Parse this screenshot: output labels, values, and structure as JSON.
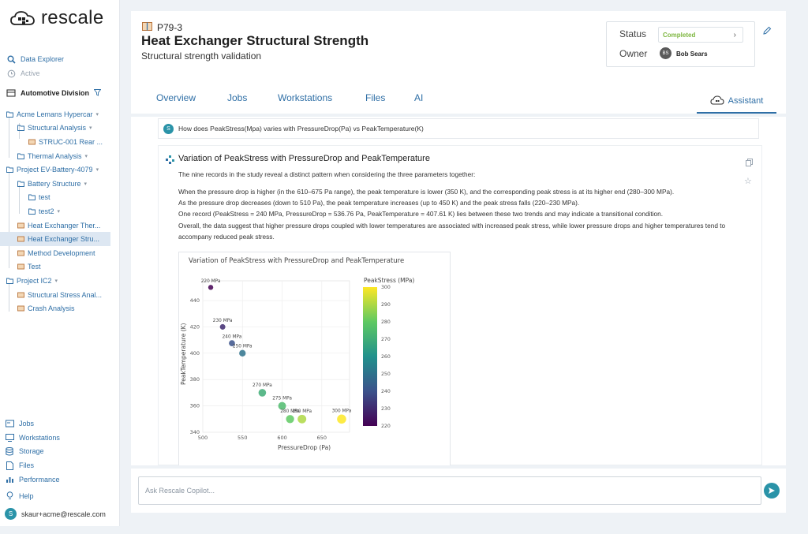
{
  "app": {
    "name": "rescale"
  },
  "sidebar": {
    "top": [
      {
        "label": "Data Explorer",
        "icon": "search-icon"
      },
      {
        "label": "Active",
        "icon": "clock-icon"
      }
    ],
    "division": "Automotive Division",
    "tree": [
      {
        "label": "Acme Lemans Hypercar",
        "caret": "▾"
      },
      {
        "label": "Structural Analysis",
        "caret": "▾"
      },
      {
        "label": "STRUC-001 Rear ...",
        "caret": ""
      },
      {
        "label": "Thermal Analysis",
        "caret": "▾"
      },
      {
        "label": "Project EV-Battery-4079",
        "caret": "▾"
      },
      {
        "label": "Battery Structure",
        "caret": "▾"
      },
      {
        "label": "test",
        "caret": ""
      },
      {
        "label": "test2",
        "caret": "▾"
      },
      {
        "label": "Heat Exchanger Ther...",
        "caret": ""
      },
      {
        "label": "Heat Exchanger Stru...",
        "caret": ""
      },
      {
        "label": "Method Development",
        "caret": ""
      },
      {
        "label": "Test",
        "caret": ""
      },
      {
        "label": "Project IC2",
        "caret": "▾"
      },
      {
        "label": "Structural Stress Anal...",
        "caret": ""
      },
      {
        "label": "Crash Analysis",
        "caret": ""
      }
    ],
    "bottom": [
      {
        "label": "Jobs",
        "icon": "jobs-icon"
      },
      {
        "label": "Workstations",
        "icon": "monitor-icon"
      },
      {
        "label": "Storage",
        "icon": "database-icon"
      },
      {
        "label": "Files",
        "icon": "file-icon"
      },
      {
        "label": "Performance",
        "icon": "chart-icon"
      },
      {
        "label": "Help",
        "icon": "lightbulb-icon"
      }
    ],
    "user": {
      "initial": "S",
      "email": "skaur+acme@rescale.com"
    }
  },
  "project": {
    "id": "P79-3",
    "title": "Heat Exchanger Structural Strength",
    "subtitle": "Structural strength validation",
    "status_label": "Status",
    "status_value": "Completed",
    "owner_label": "Owner",
    "owner_initials": "BS",
    "owner_name": "Bob Sears"
  },
  "tabs": [
    "Overview",
    "Jobs",
    "Workstations",
    "Files",
    "AI"
  ],
  "assistant_tab": "Assistant",
  "chat": {
    "question_avatar": "S",
    "question": "How does PeakStress(Mpa) varies with PressureDrop(Pa) vs PeakTemperature(K)",
    "answer_title": "Variation of PeakStress with PressureDrop and PeakTemperature",
    "answer_intro": "The nine records in the study reveal a distinct pattern when considering the three parameters together:",
    "answer_paras": [
      "When the pressure drop is higher (in the 610–675 Pa range), the peak temperature is lower (350 K), and the corresponding peak stress is at its higher end (280–300 MPa).",
      "As the pressure drop decreases (down to 510 Pa), the peak temperature increases (up to 450 K) and the peak stress falls (220–230 MPa).",
      "One record (PeakStress = 240 MPa, PressureDrop = 536.76 Pa, PeakTemperature = 407.61 K) lies between these two trends and may indicate a transitional condition.",
      "Overall, the data suggest that higher pressure drops coupled with lower temperatures are associated with increased peak stress, while lower pressure drops and higher temperatures tend to accompany reduced peak stress."
    ],
    "input_placeholder": "Ask Rescale Copilot..."
  },
  "colors": {
    "accent": "#2f6fa6",
    "status_green": "#7db63f",
    "teal": "#2a93a8"
  },
  "chart_data": {
    "type": "scatter",
    "title": "Variation of PeakStress with PressureDrop and PeakTemperature",
    "xlabel": "PressureDrop (Pa)",
    "ylabel": "PeakTemperature (K)",
    "colorbar_label": "PeakStress (MPa)",
    "xlim": [
      500,
      685
    ],
    "ylim": [
      340,
      455
    ],
    "xticks": [
      500,
      550,
      600,
      650
    ],
    "yticks": [
      340,
      360,
      380,
      400,
      420,
      440
    ],
    "clim": [
      220,
      300
    ],
    "cticks": [
      220,
      230,
      240,
      250,
      260,
      270,
      280,
      290,
      300
    ],
    "grid": true,
    "points": [
      {
        "x": 510,
        "y": 450,
        "stress": 220,
        "label": "220 MPa"
      },
      {
        "x": 525,
        "y": 420,
        "stress": 230,
        "label": "230 MPa"
      },
      {
        "x": 536.76,
        "y": 407.61,
        "stress": 240,
        "label": "240 MPa"
      },
      {
        "x": 550,
        "y": 400,
        "stress": 250,
        "label": "250 MPa"
      },
      {
        "x": 575,
        "y": 370,
        "stress": 270,
        "label": "270 MPa"
      },
      {
        "x": 600,
        "y": 360,
        "stress": 275,
        "label": "275 MPa"
      },
      {
        "x": 610,
        "y": 350,
        "stress": 280,
        "label": "280 MPa"
      },
      {
        "x": 625,
        "y": 350,
        "stress": 290,
        "label": "290 MPa"
      },
      {
        "x": 675,
        "y": 350,
        "stress": 300,
        "label": "300 MPa"
      }
    ]
  }
}
